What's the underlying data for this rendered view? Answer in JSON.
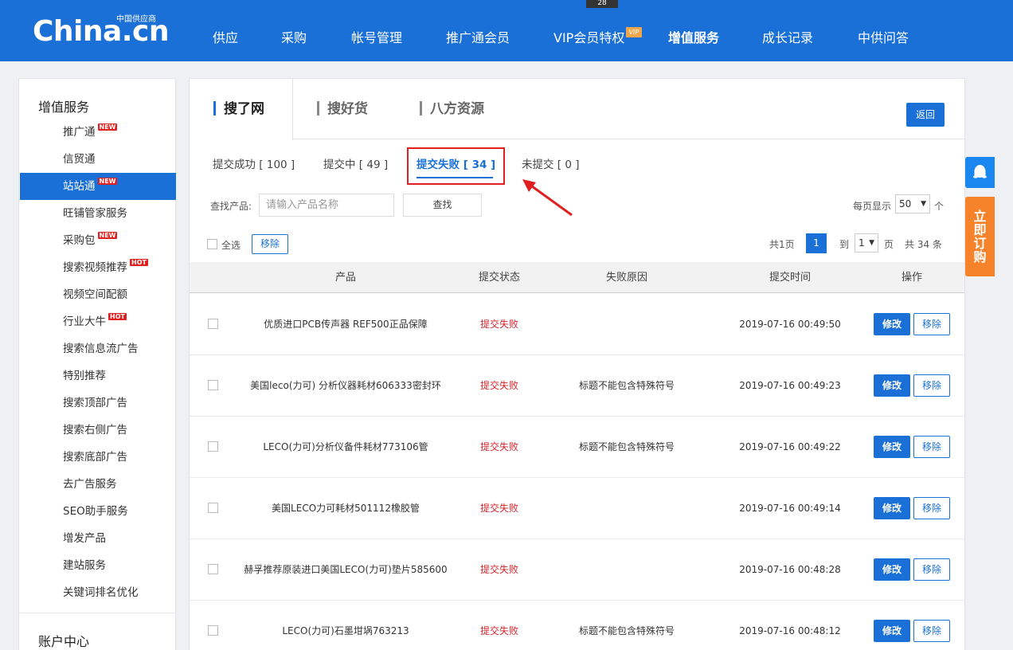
{
  "header": {
    "logo_text": "China.cn",
    "logo_sub": "中国供应商",
    "counter": "28",
    "nav": [
      "供应",
      "采购",
      "帐号管理",
      "推广通会员",
      "VIP会员特权",
      "增值服务",
      "成长记录",
      "中供问答"
    ],
    "vip_badge": "VIP",
    "active_nav": "增值服务"
  },
  "sidebar": {
    "title": "增值服务",
    "items": [
      {
        "label": "推广通",
        "tag": "NEW"
      },
      {
        "label": "信贸通",
        "tag": ""
      },
      {
        "label": "站站通",
        "tag": "NEW"
      },
      {
        "label": "旺铺管家服务",
        "tag": ""
      },
      {
        "label": "采购包",
        "tag": "NEW"
      },
      {
        "label": "搜索视频推荐",
        "tag": "HOT"
      },
      {
        "label": "视频空间配额",
        "tag": ""
      },
      {
        "label": "行业大牛",
        "tag": "HOT"
      },
      {
        "label": "搜索信息流广告",
        "tag": ""
      },
      {
        "label": "特别推荐",
        "tag": ""
      },
      {
        "label": "搜索顶部广告",
        "tag": ""
      },
      {
        "label": "搜索右侧广告",
        "tag": ""
      },
      {
        "label": "搜索底部广告",
        "tag": ""
      },
      {
        "label": "去广告服务",
        "tag": ""
      },
      {
        "label": "SEO助手服务",
        "tag": ""
      },
      {
        "label": "增发产品",
        "tag": ""
      },
      {
        "label": "建站服务",
        "tag": ""
      },
      {
        "label": "关键词排名优化",
        "tag": ""
      }
    ],
    "active_item": "站站通",
    "account_title": "账户中心"
  },
  "tabs": [
    "搜了网",
    "搜好货",
    "八方资源"
  ],
  "back_button": "返回",
  "subtabs": [
    "提交成功 [ 100 ]",
    "提交中 [ 49 ]",
    "提交失败 [ 34 ]",
    "未提交 [ 0 ]"
  ],
  "search": {
    "label": "查找产品:",
    "placeholder": "请输入产品名称",
    "button": "查找"
  },
  "page_size": {
    "label": "每页显示",
    "value": "50",
    "unit": "个"
  },
  "toolbar": {
    "select_all": "全选",
    "remove": "移除"
  },
  "pagination": {
    "total_pages": "共1页",
    "current": "1",
    "goto_label": "到",
    "goto_value": "1",
    "page_unit": "页",
    "total_items": "共 34 条"
  },
  "table": {
    "headers": [
      "产品",
      "提交状态",
      "失败原因",
      "提交时间",
      "操作"
    ],
    "rows": [
      {
        "product": "优质进口PCB传声器 REF500正品保障",
        "status": "提交失败",
        "reason": "",
        "time": "2019-07-16 00:49:50"
      },
      {
        "product": "美国leco(力可) 分析仪器耗材606333密封环",
        "status": "提交失败",
        "reason": "标题不能包含特殊符号",
        "time": "2019-07-16 00:49:23"
      },
      {
        "product": "LECO(力可)分析仪备件耗材773106管",
        "status": "提交失败",
        "reason": "标题不能包含特殊符号",
        "time": "2019-07-16 00:49:22"
      },
      {
        "product": "美国LECO力可耗材501112橡胶管",
        "status": "提交失败",
        "reason": "",
        "time": "2019-07-16 00:49:14"
      },
      {
        "product": "赫孚推荐原装进口美国LECO(力可)垫片585600",
        "status": "提交失败",
        "reason": "",
        "time": "2019-07-16 00:48:28"
      },
      {
        "product": "LECO(力可)石墨坩埚763213",
        "status": "提交失败",
        "reason": "标题不能包含特殊符号",
        "time": "2019-07-16 00:48:12"
      }
    ],
    "edit_label": "修改",
    "remove_label": "移除"
  },
  "floats": {
    "order_text": [
      "立",
      "即",
      "订",
      "购"
    ]
  },
  "colors": {
    "brand_blue": "#1a70d6",
    "fail_red": "#d0262c",
    "annotation_red": "#e02020",
    "order_orange": "#f6822a"
  }
}
